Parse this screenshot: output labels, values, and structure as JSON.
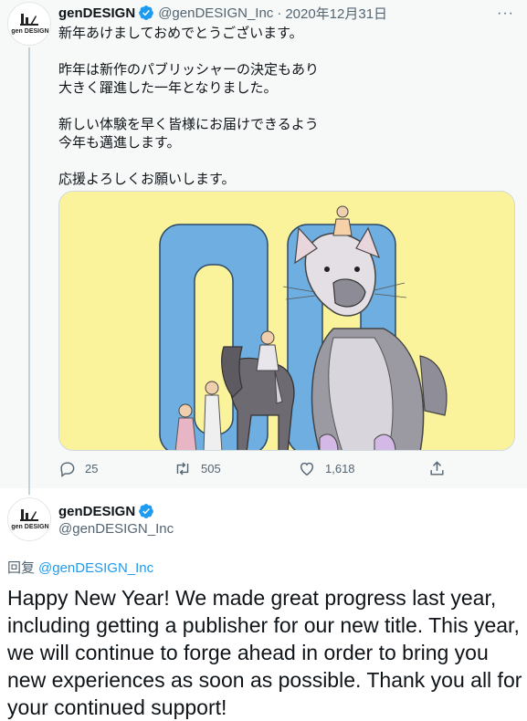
{
  "parent_tweet": {
    "author": {
      "name": "genDESIGN",
      "handle": "@genDESIGN_Inc",
      "avatar_text": "gen DESIGN"
    },
    "separator": "·",
    "date": "2020年12月31日",
    "text_lines": [
      "新年あけましておめでとうございます。",
      "",
      "昨年は新作のパブリッシャーの決定もあり",
      "大きく躍進した一年となりました。",
      "",
      "新しい体験を早く皆様にお届けできるよう",
      "今年も邁進します。",
      "",
      "応援よろしくお願いします。"
    ],
    "media": {
      "type": "illustration",
      "colors": {
        "background": "#fbf29c",
        "letters": "#6eaee0"
      }
    },
    "actions": {
      "reply_count": "25",
      "retweet_count": "505",
      "like_count": "1,618"
    },
    "more_icon": "···"
  },
  "reply_tweet": {
    "author": {
      "name": "genDESIGN",
      "handle": "@genDESIGN_Inc",
      "avatar_text": "gen DESIGN"
    },
    "reply_to_label": "回复",
    "reply_to_handle": "@genDESIGN_Inc",
    "text_lines": [
      "Happy New Year! We made great progress last year,",
      "including getting a publisher for our new title. This year,",
      "we will continue to forge ahead in order to bring you",
      "new experiences as soon as possible. Thank you all for",
      "your continued support!"
    ]
  },
  "colors": {
    "verified": "#1d9bf0",
    "secondary_text": "#536471",
    "link": "#1d9bf0",
    "thread_line": "#c4cfd6"
  }
}
